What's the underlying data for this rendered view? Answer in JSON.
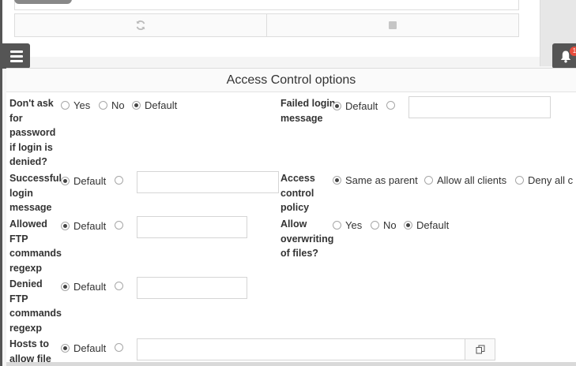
{
  "panel": {
    "title": "Access Control options"
  },
  "rows": {
    "dont_ask": {
      "label_lines": [
        "Don't ask",
        "for",
        "password",
        "if login is",
        "denied?"
      ],
      "options": [
        "Yes",
        "No",
        "Default"
      ]
    },
    "failed_login": {
      "label_lines": [
        "Failed login",
        "message"
      ],
      "options": [
        "Default"
      ],
      "value": ""
    },
    "successful_login": {
      "label_lines": [
        "Successful",
        "login",
        "message"
      ],
      "options": [
        "Default"
      ],
      "value": ""
    },
    "access_policy": {
      "label_lines": [
        "Access",
        "control",
        "policy"
      ],
      "options": [
        "Same as parent",
        "Allow all clients",
        "Deny all c"
      ]
    },
    "allowed_ftp": {
      "label_lines": [
        "Allowed",
        "FTP",
        "commands",
        "regexp"
      ],
      "options": [
        "Default"
      ],
      "value": ""
    },
    "allow_overwrite": {
      "label_lines": [
        "Allow",
        "overwriting",
        "of files?"
      ],
      "options": [
        "Yes",
        "No",
        "Default"
      ]
    },
    "denied_ftp": {
      "label_lines": [
        "Denied",
        "FTP",
        "commands",
        "regexp"
      ],
      "options": [
        "Default"
      ],
      "value": ""
    },
    "hosts_allow": {
      "label_lines": [
        "Hosts to",
        "allow file"
      ],
      "options": [
        "Default"
      ],
      "value": ""
    }
  },
  "notifications": {
    "count": "1"
  },
  "icons": {
    "refresh": "refresh-icon",
    "stop": "stop-icon",
    "menu": "menu-icon",
    "bell": "bell-icon",
    "copy": "copy-icon"
  },
  "colors": {
    "sidebar_buttons": "#555555",
    "badge": "#e74c3c"
  }
}
